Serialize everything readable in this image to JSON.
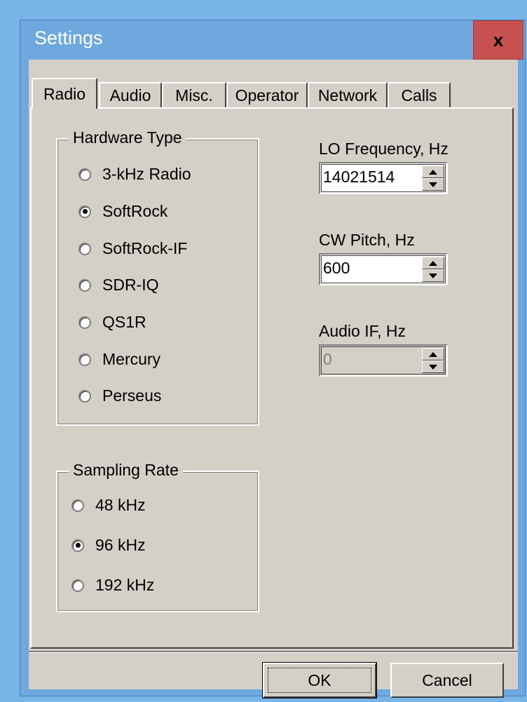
{
  "window": {
    "title": "Settings",
    "close_label": "x"
  },
  "tabs": [
    {
      "label": "Radio",
      "active": true
    },
    {
      "label": "Audio",
      "active": false
    },
    {
      "label": "Misc.",
      "active": false
    },
    {
      "label": "Operator",
      "active": false
    },
    {
      "label": "Network",
      "active": false
    },
    {
      "label": "Calls",
      "active": false
    }
  ],
  "hardware_type": {
    "title": "Hardware Type",
    "options": [
      {
        "label": "3-kHz Radio",
        "selected": false
      },
      {
        "label": "SoftRock",
        "selected": true
      },
      {
        "label": "SoftRock-IF",
        "selected": false
      },
      {
        "label": "SDR-IQ",
        "selected": false
      },
      {
        "label": "QS1R",
        "selected": false
      },
      {
        "label": "Mercury",
        "selected": false
      },
      {
        "label": "Perseus",
        "selected": false
      }
    ]
  },
  "sampling_rate": {
    "title": "Sampling Rate",
    "options": [
      {
        "label": "48 kHz",
        "selected": false
      },
      {
        "label": "96 kHz",
        "selected": true
      },
      {
        "label": "192 kHz",
        "selected": false
      }
    ]
  },
  "fields": {
    "lo_frequency": {
      "label": "LO Frequency, Hz",
      "value": "14021514",
      "enabled": true
    },
    "cw_pitch": {
      "label": "CW Pitch, Hz",
      "value": "600",
      "enabled": true
    },
    "audio_if": {
      "label": "Audio IF, Hz",
      "value": "0",
      "enabled": false
    }
  },
  "buttons": {
    "ok": "OK",
    "cancel": "Cancel"
  }
}
